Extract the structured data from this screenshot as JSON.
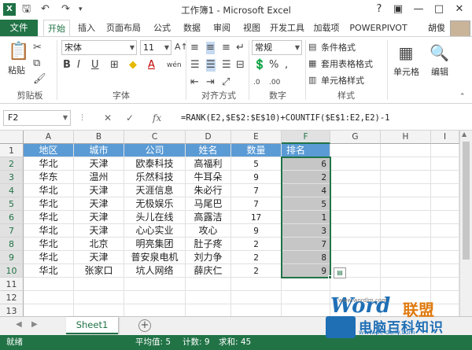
{
  "window": {
    "title": "工作簿1 - Microsoft Excel",
    "app_icon": "X"
  },
  "ribbon_tabs": [
    "开始",
    "插入",
    "页面布局",
    "公式",
    "数据",
    "审阅",
    "视图",
    "开发工具",
    "加载项",
    "POWERPIVOT"
  ],
  "file_tab": "文件",
  "user_name": "胡俊",
  "ribbon": {
    "paste_label": "粘贴",
    "font_name": "宋体",
    "font_size": "11",
    "number_format": "常规",
    "conditional_format": "条件格式",
    "table_format": "套用表格格式",
    "cell_style": "单元格样式",
    "cells_label": "单元格",
    "edit_label": "编辑",
    "groups": {
      "clipboard": "剪贴板",
      "font": "字体",
      "alignment": "对齐方式",
      "number": "数字",
      "styles": "样式"
    }
  },
  "formula_bar": {
    "name_box": "F2",
    "fx": "fx",
    "formula": "=RANK(E2,$E$2:$E$10)+COUNTIF($E$1:E2,E2)-1"
  },
  "columns": [
    "A",
    "B",
    "C",
    "D",
    "E",
    "F",
    "G",
    "H",
    "I"
  ],
  "rows": [
    "1",
    "2",
    "3",
    "4",
    "5",
    "6",
    "7",
    "8",
    "9",
    "10",
    "11",
    "12",
    "13",
    "14"
  ],
  "table": {
    "headers": [
      "地区",
      "城市",
      "公司",
      "姓名",
      "数量",
      "排名"
    ],
    "rows": [
      [
        "华北",
        "天津",
        "欧泰科技",
        "高福利",
        "5",
        "6"
      ],
      [
        "华东",
        "温州",
        "乐然科技",
        "牛耳朵",
        "9",
        "2"
      ],
      [
        "华北",
        "天津",
        "天涯信息",
        "朱必行",
        "7",
        "4"
      ],
      [
        "华北",
        "天津",
        "无极娱乐",
        "马尾巴",
        "7",
        "5"
      ],
      [
        "华北",
        "天津",
        "头儿在线",
        "高露洁",
        "17",
        "1"
      ],
      [
        "华北",
        "天津",
        "心心实业",
        "攻心",
        "9",
        "3"
      ],
      [
        "华北",
        "北京",
        "明亮集团",
        "肚子疼",
        "2",
        "7"
      ],
      [
        "华北",
        "天津",
        "普安泉电机",
        "刘力争",
        "2",
        "8"
      ],
      [
        "华北",
        "张家口",
        "坑人网络",
        "薛庆仁",
        "2",
        "9"
      ]
    ]
  },
  "sheet_tab": "Sheet1",
  "status": {
    "ready": "就绪",
    "average": "平均值: 5",
    "count": "计数: 9",
    "sum": "求和: 45"
  },
  "watermark": {
    "word": "Word",
    "meng": "联盟",
    "url": "www.wordlm.com",
    "brand": "电脑百科知识",
    "url2": "www.pc-daily.com"
  }
}
